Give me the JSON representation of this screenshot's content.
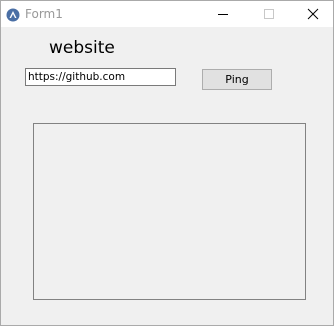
{
  "window": {
    "title": "Form1",
    "app_icon": "app-icon",
    "controls": {
      "minimize_icon": "minimize-icon",
      "maximize_icon": "maximize-icon",
      "close_icon": "close-icon"
    }
  },
  "form": {
    "heading": "website",
    "url_value": "https://github.com",
    "ping_label": "Ping"
  },
  "colors": {
    "form_background": "#f0f0f0",
    "titlebar_background": "#ffffff",
    "button_background": "#e1e1e1"
  }
}
